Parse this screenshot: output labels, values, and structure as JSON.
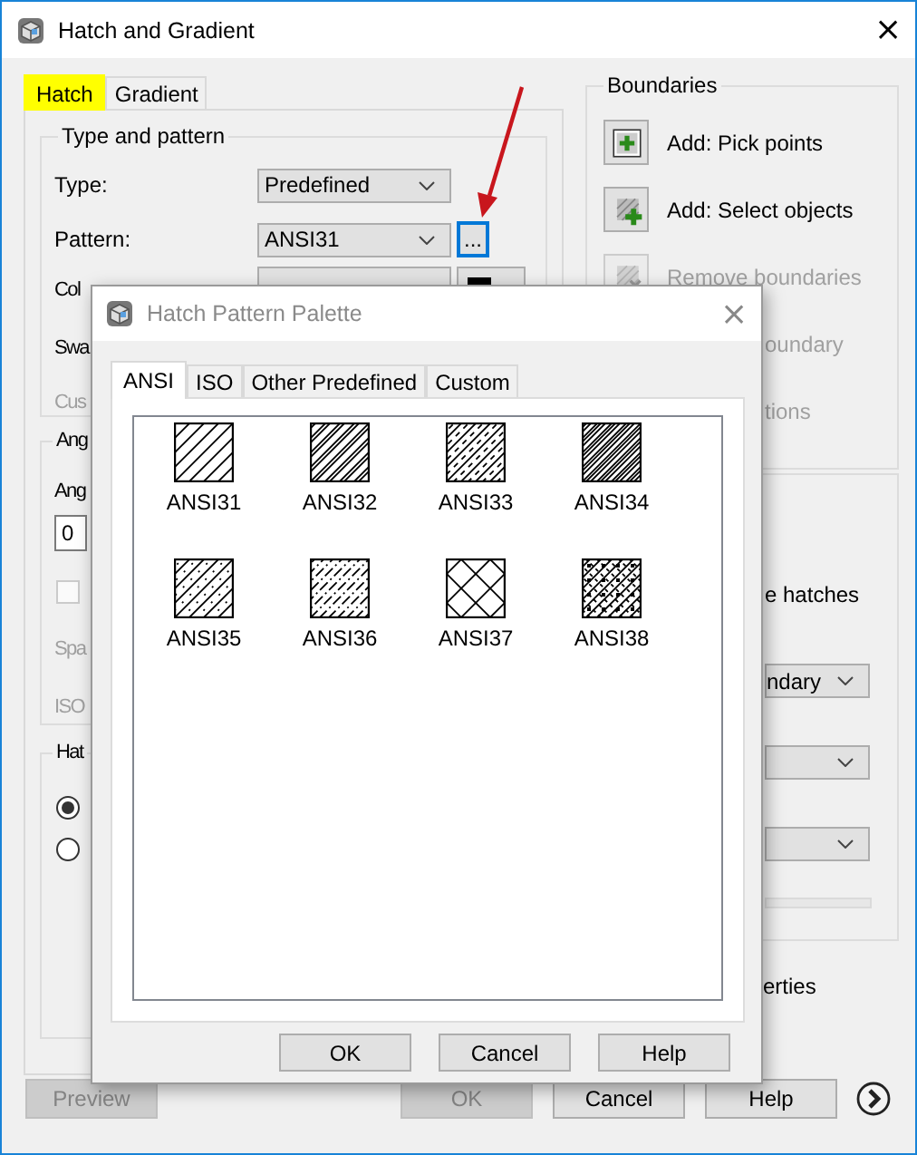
{
  "window": {
    "title": "Hatch and Gradient",
    "close": "×"
  },
  "tabs": [
    {
      "label": "Hatch",
      "selected": true
    },
    {
      "label": "Gradient",
      "selected": false
    }
  ],
  "type_and_pattern": {
    "title": "Type and pattern",
    "type_label": "Type:",
    "type_value": "Predefined",
    "pattern_label": "Pattern:",
    "pattern_value": "ANSI31",
    "browse": "...",
    "color_label": "Col",
    "swatch_label": "Swa",
    "custom_label": "Cus"
  },
  "angle_group": {
    "title": "Ang",
    "angle_label": "Ang",
    "angle_value": "0",
    "checkbox": {
      "checked": false,
      "disabled": true
    },
    "spacing_label": "Spa",
    "iso_label": "ISO"
  },
  "hatch_origin": {
    "title": "Hat",
    "radios": [
      {
        "selected": true
      },
      {
        "selected": false
      }
    ]
  },
  "boundaries": {
    "title": "Boundaries",
    "items": [
      {
        "kind": "pick",
        "label": "Add: Pick points",
        "disabled": false
      },
      {
        "kind": "select",
        "label": "Add: Select objects",
        "disabled": false
      },
      {
        "kind": "remove",
        "label": "Remove boundaries",
        "disabled": true
      },
      {
        "kind": "text",
        "label": "oundary",
        "disabled": true
      },
      {
        "kind": "text",
        "label": "tions",
        "disabled": true
      }
    ]
  },
  "options": {
    "items": [
      {
        "kind": "text",
        "label": "e hatches"
      },
      {
        "kind": "dropdown",
        "value": "ndary"
      },
      {
        "kind": "dropdown"
      },
      {
        "kind": "dropdown"
      },
      {
        "kind": "track"
      }
    ]
  },
  "properties_label": "erties",
  "buttons": [
    {
      "label": "Preview",
      "disabled": true
    },
    {
      "label": "OK",
      "disabled": true
    },
    {
      "label": "Cancel",
      "disabled": false
    },
    {
      "label": "Help",
      "disabled": false
    }
  ],
  "palette": {
    "title": "Hatch Pattern Palette",
    "close": "×",
    "tabs": [
      {
        "label": "ANSI",
        "selected": true
      },
      {
        "label": "ISO",
        "selected": false
      },
      {
        "label": "Other Predefined",
        "selected": false
      },
      {
        "label": "Custom",
        "selected": false
      }
    ],
    "patterns": [
      {
        "name": "ANSI31",
        "kind": "single"
      },
      {
        "name": "ANSI32",
        "kind": "double"
      },
      {
        "name": "ANSI33",
        "kind": "dashed"
      },
      {
        "name": "ANSI34",
        "kind": "triple"
      },
      {
        "name": "ANSI35",
        "kind": "dashdot"
      },
      {
        "name": "ANSI36",
        "kind": "broken"
      },
      {
        "name": "ANSI37",
        "kind": "cross"
      },
      {
        "name": "ANSI38",
        "kind": "crossdense"
      }
    ],
    "buttons": [
      "OK",
      "Cancel",
      "Help"
    ]
  }
}
